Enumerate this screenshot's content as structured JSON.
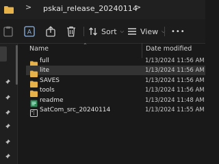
{
  "address_bar": {
    "separator": ">",
    "path_segment": "pskai_release_20240114"
  },
  "toolbar": {
    "sort_label": "Sort",
    "view_label": "View",
    "more_label": "•••"
  },
  "columns": {
    "name": "Name",
    "date_modified": "Date modified"
  },
  "files": [
    {
      "name": "full",
      "date": "1/13/2024 11:56 AM",
      "icon": "folder-icon",
      "selected": false
    },
    {
      "name": "lite",
      "date": "1/13/2024 11:56 AM",
      "icon": "folder-icon",
      "selected": true
    },
    {
      "name": "SAVES",
      "date": "1/13/2024 11:56 AM",
      "icon": "folder-icon",
      "selected": false
    },
    {
      "name": "tools",
      "date": "1/13/2024 11:56 AM",
      "icon": "folder-icon",
      "selected": false
    },
    {
      "name": "readme",
      "date": "1/13/2024 11:48 AM",
      "icon": "text-file-icon",
      "selected": false
    },
    {
      "name": "SatCom_src_20240114",
      "date": "1/13/2024 11:55 AM",
      "icon": "archive-file-icon",
      "selected": false
    }
  ],
  "colors": {
    "background": "#191919",
    "folder": "#e8b24a",
    "selected_row": "#333333"
  }
}
